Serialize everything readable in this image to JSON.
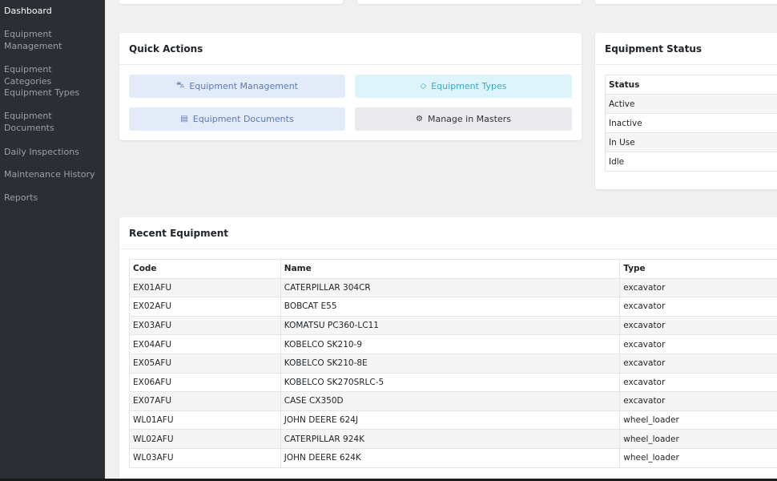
{
  "sidebar": {
    "items": [
      {
        "label": "Dashboard"
      },
      {
        "label": "Equipment\nManagement"
      },
      {
        "label": "Equipment Categories"
      },
      {
        "label": "Equipment Types"
      },
      {
        "label": "Equipment\nDocuments"
      },
      {
        "label": "Daily Inspections"
      },
      {
        "label": "Maintenance History"
      },
      {
        "label": "Reports"
      }
    ]
  },
  "quick_actions": {
    "title": "Quick Actions",
    "buttons": [
      {
        "label": "Equipment Management",
        "icon": "car-icon"
      },
      {
        "label": "Equipment Types",
        "icon": "tag-icon"
      },
      {
        "label": "Equipment Documents",
        "icon": "file-icon"
      },
      {
        "label": "Manage in Masters",
        "icon": "gear-icon"
      }
    ]
  },
  "equipment_status": {
    "title": "Equipment Status",
    "header": "Status",
    "rows": [
      "Active",
      "Inactive",
      "In Use",
      "Idle"
    ]
  },
  "recent_equipment": {
    "title": "Recent Equipment",
    "columns": [
      "Code",
      "Name",
      "Type"
    ],
    "rows": [
      {
        "code": "EX01AFU",
        "name": "CATERPILLAR 304CR",
        "type": "excavator"
      },
      {
        "code": "EX02AFU",
        "name": "BOBCAT E55",
        "type": "excavator"
      },
      {
        "code": "EX03AFU",
        "name": "KOMATSU PC360-LC11",
        "type": "excavator"
      },
      {
        "code": "EX04AFU",
        "name": "KOBELCO SK210-9",
        "type": "excavator"
      },
      {
        "code": "EX05AFU",
        "name": "KOBELCO SK210-8E",
        "type": "excavator"
      },
      {
        "code": "EX06AFU",
        "name": "KOBELCO SK270SRLC-5",
        "type": "excavator"
      },
      {
        "code": "EX07AFU",
        "name": "CASE CX350D",
        "type": "excavator"
      },
      {
        "code": "WL01AFU",
        "name": "JOHN DEERE 624J",
        "type": "wheel_loader"
      },
      {
        "code": "WL02AFU",
        "name": "CATERPILLAR 924K",
        "type": "wheel_loader"
      },
      {
        "code": "WL03AFU",
        "name": "JOHN DEERE 624K",
        "type": "wheel_loader"
      }
    ]
  },
  "colors": {
    "sidebar_bg": "#2b2f33",
    "btn_primary_bg": "#e4ebf8",
    "btn_primary_fg": "#5b7bb3",
    "btn_info_bg": "#ddf4fb",
    "btn_info_fg": "#36a9c9",
    "btn_secondary_bg": "#e9e9ee",
    "btn_secondary_fg": "#333333"
  }
}
